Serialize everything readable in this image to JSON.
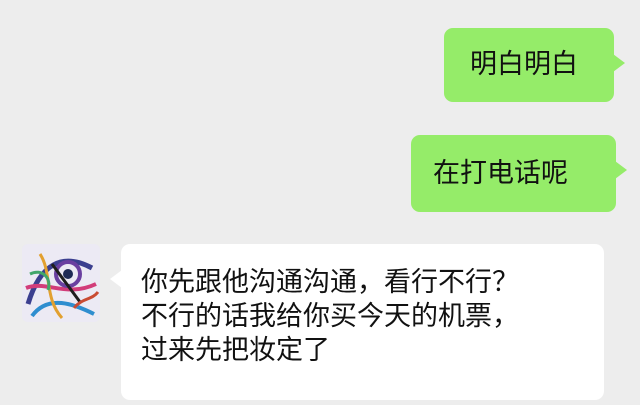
{
  "messages": [
    {
      "sender": "me",
      "text": "明白明白"
    },
    {
      "sender": "me",
      "text": "在打电话呢"
    },
    {
      "sender": "other",
      "avatar_icon": "abstract-art-avatar-icon",
      "lines": [
        "你先跟他沟通沟通，看行不行？",
        "不行的话我给你买今天的机票，",
        "过来先把妆定了"
      ]
    }
  ],
  "colors": {
    "background": "#ededed",
    "my_bubble": "#95ec69",
    "other_bubble": "#ffffff",
    "text": "#111111"
  }
}
